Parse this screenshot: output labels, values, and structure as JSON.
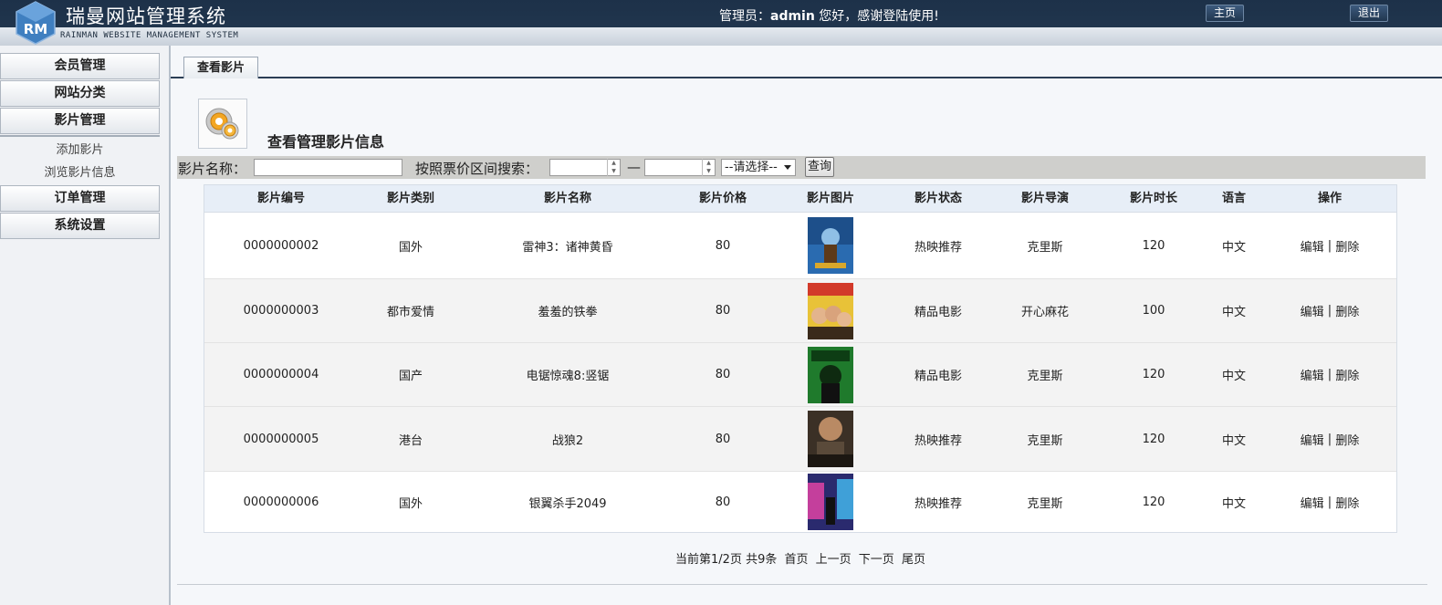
{
  "header": {
    "app_title": "瑞曼网站管理系统",
    "app_subtitle": "RAINMAN WEBSITE MANAGEMENT SYSTEM",
    "logo_text": "RM",
    "welcome_prefix": "管理员：",
    "username": "admin",
    "welcome_suffix": " 您好，感谢登陆使用!",
    "home_label": "主页",
    "logout_label": "退出"
  },
  "sidebar": {
    "items": [
      {
        "label": "会员管理"
      },
      {
        "label": "网站分类"
      },
      {
        "label": "影片管理"
      },
      {
        "label": "订单管理"
      },
      {
        "label": "系统设置"
      }
    ],
    "subitems": [
      {
        "label": "添加影片"
      },
      {
        "label": "浏览影片信息"
      }
    ]
  },
  "main": {
    "tab_label": "查看影片",
    "page_title": "查看管理影片信息",
    "search": {
      "name_label": "影片名称：",
      "name_value": "",
      "price_label": "按照票价区间搜索：",
      "dash": "—",
      "price_min": "",
      "price_max": "",
      "select_value": "--请选择--",
      "query_label": "查询"
    },
    "table": {
      "headers": [
        "影片编号",
        "影片类别",
        "影片名称",
        "影片价格",
        "影片图片",
        "影片状态",
        "影片导演",
        "影片时长",
        "语言",
        "操作"
      ],
      "rows": [
        {
          "id": "0000000002",
          "category": "国外",
          "name": "雷神3：诸神黄昏",
          "price": "80",
          "status": "热映推荐",
          "director": "克里斯",
          "duration": "120",
          "language": "中文",
          "edit": "编辑",
          "sep": "|",
          "del": "删除"
        },
        {
          "id": "0000000003",
          "category": "都市爱情",
          "name": "羞羞的铁拳",
          "price": "80",
          "status": "精品电影",
          "director": "开心麻花",
          "duration": "100",
          "language": "中文",
          "edit": "编辑",
          "sep": "|",
          "del": "删除"
        },
        {
          "id": "0000000004",
          "category": "国产",
          "name": "电锯惊魂8:竖锯",
          "price": "80",
          "status": "精品电影",
          "director": "克里斯",
          "duration": "120",
          "language": "中文",
          "edit": "编辑",
          "sep": "|",
          "del": "删除"
        },
        {
          "id": "0000000005",
          "category": "港台",
          "name": "战狼2",
          "price": "80",
          "status": "热映推荐",
          "director": "克里斯",
          "duration": "120",
          "language": "中文",
          "edit": "编辑",
          "sep": "|",
          "del": "删除"
        },
        {
          "id": "0000000006",
          "category": "国外",
          "name": "银翼杀手2049",
          "price": "80",
          "status": "热映推荐",
          "director": "克里斯",
          "duration": "120",
          "language": "中文",
          "edit": "编辑",
          "sep": "|",
          "del": "删除"
        }
      ]
    },
    "pager": {
      "info": "当前第1/2页 共9条",
      "first": "首页",
      "prev": "上一页",
      "next": "下一页",
      "last": "尾页"
    }
  },
  "colors": {
    "header_bg": "#1d3149",
    "table_header_bg": "#e7eef7",
    "search_bar_bg": "#cfcfcc"
  }
}
